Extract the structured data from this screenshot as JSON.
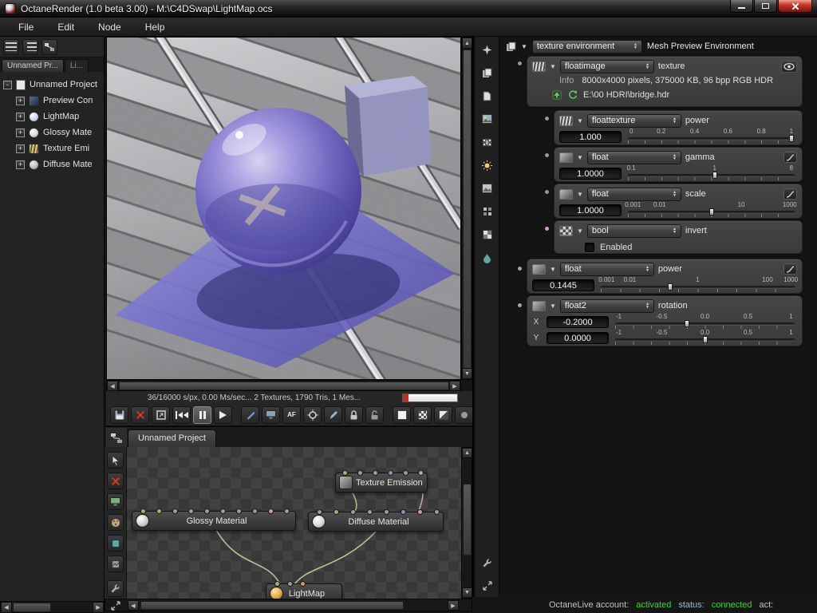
{
  "colors": {
    "status_green": "#35d435",
    "close_red": "#c43828",
    "plane_blue": "#6e6ac8"
  },
  "window": {
    "title": "OctaneRender (1.0 beta 3.00) - M:\\C4DSwap\\LightMap.ocs"
  },
  "menu": {
    "items": [
      "File",
      "Edit",
      "Node",
      "Help"
    ]
  },
  "project_panel": {
    "tabs": [
      {
        "label": "Unnamed Pr..."
      },
      {
        "label": "Li..."
      }
    ],
    "root_label": "Unnamed Project",
    "items": [
      {
        "label": "Preview Con"
      },
      {
        "label": "LightMap"
      },
      {
        "label": "Glossy Mate"
      },
      {
        "label": "Texture Emi"
      },
      {
        "label": "Diffuse Mate"
      }
    ]
  },
  "viewport": {
    "status_text": "36/16000 s/px, 0.00 Ms/sec... 2 Textures, 1790 Tris, 1 Mes..."
  },
  "render_toolbar": {
    "af_label": "AF"
  },
  "node_graph": {
    "tab_label": "Unnamed Project",
    "nodes": [
      {
        "label": "Texture Emission"
      },
      {
        "label": "Glossy Material"
      },
      {
        "label": "Diffuse Material"
      },
      {
        "label": "LightMap"
      }
    ]
  },
  "inspector": {
    "root": {
      "type": "texture environment",
      "label": "Mesh Preview Environment"
    },
    "texture_group": {
      "type": "floatimage",
      "name": "texture",
      "info_label": "Info",
      "info_value": "8000x4000 pixels, 375000 KB, 96 bpp RGB HDR",
      "path": "E:\\00 HDRI\\bridge.hdr"
    },
    "params": [
      {
        "type": "floattexture",
        "name": "power",
        "value": "1.000",
        "ticks": [
          "0",
          "0.2",
          "0.4",
          "0.6",
          "0.8",
          "1"
        ]
      },
      {
        "type": "float",
        "name": "gamma",
        "value": "1.0000",
        "ticks": [
          "0.1",
          "1",
          "8"
        ]
      },
      {
        "type": "float",
        "name": "scale",
        "value": "1.0000",
        "ticks": [
          "0.001",
          "0.01",
          "10",
          "1000"
        ]
      },
      {
        "type": "bool",
        "name": "invert",
        "checkbox_label": "Enabled"
      },
      {
        "type": "float",
        "name": "power",
        "value": "0.1445",
        "ticks": [
          "0.001",
          "0.01",
          "1",
          "100",
          "1000"
        ]
      },
      {
        "type": "float2",
        "name": "rotation",
        "x_label": "X",
        "x_value": "-0.2000",
        "y_label": "Y",
        "y_value": "0.0000",
        "ticks": [
          "-1",
          "-0.5",
          "0.0",
          "0.5",
          "1"
        ]
      }
    ]
  },
  "account_bar": {
    "account_label": "OctaneLive account:",
    "account_value": "activated",
    "status_label": "status:",
    "status_value": "connected",
    "act_label": "act:"
  }
}
